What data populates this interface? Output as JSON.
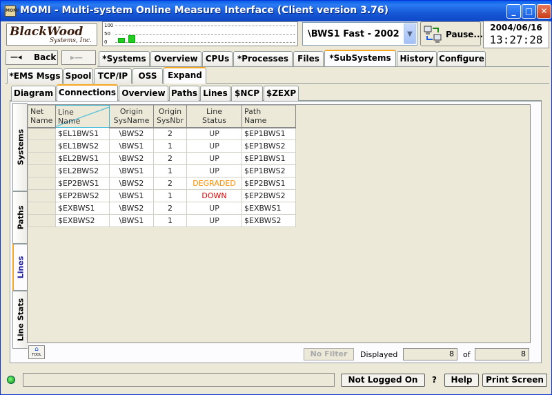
{
  "window": {
    "title": "MOMI - Multi-system Online Measure Interface (Client version 3.76)",
    "icon_text": "MOMI"
  },
  "logo": {
    "line1": "BlackWood",
    "line2": "Systems, Inc."
  },
  "graph": {
    "axis_labels": [
      "100",
      "50",
      "0"
    ],
    "bars": [
      0.3,
      0.45
    ]
  },
  "system_select": {
    "value": "\\BWS1 Fast - 2002"
  },
  "pause_button": {
    "label": "Pause..."
  },
  "clock": {
    "date": "2004/06/16",
    "time": "13:27:28"
  },
  "nav": {
    "back_label": "Back"
  },
  "main_tabs": [
    {
      "label": "*Systems"
    },
    {
      "label": "Overview"
    },
    {
      "label": "CPUs"
    },
    {
      "label": "*Processes"
    },
    {
      "label": "Files"
    },
    {
      "label": "*SubSystems",
      "selected": true
    },
    {
      "label": "History"
    },
    {
      "label": "Configure"
    }
  ],
  "sub_tabs": [
    {
      "label": "*EMS Msgs"
    },
    {
      "label": "Spool"
    },
    {
      "label": "TCP/IP"
    },
    {
      "label": "OSS"
    },
    {
      "label": "Expand",
      "selected": true
    }
  ],
  "expand_tabs": [
    {
      "label": "Diagram"
    },
    {
      "label": "Connections",
      "selected": true
    },
    {
      "label": "Overview"
    },
    {
      "label": "Paths"
    },
    {
      "label": "Lines"
    },
    {
      "label": "$NCP"
    },
    {
      "label": "$ZEXP"
    }
  ],
  "side_tabs": [
    {
      "label": "Systems"
    },
    {
      "label": "Paths"
    },
    {
      "label": "Lines",
      "selected": true
    },
    {
      "label": "Line Stats"
    }
  ],
  "table": {
    "headers": [
      [
        "Net",
        "Name"
      ],
      [
        "Line",
        "Name"
      ],
      [
        "Origin",
        "SysName"
      ],
      [
        "Origin",
        "SysNbr"
      ],
      [
        "Line",
        "Status"
      ],
      [
        "Path",
        "Name"
      ]
    ],
    "rows": [
      {
        "net": "",
        "line": "$EL1BWS1",
        "sysname": "\\BWS2",
        "sysnbr": "2",
        "status": "UP",
        "path": "$EP1BWS1"
      },
      {
        "net": "",
        "line": "$EL1BWS2",
        "sysname": "\\BWS1",
        "sysnbr": "1",
        "status": "UP",
        "path": "$EP1BWS2"
      },
      {
        "net": "",
        "line": "$EL2BWS1",
        "sysname": "\\BWS2",
        "sysnbr": "2",
        "status": "UP",
        "path": "$EP1BWS1"
      },
      {
        "net": "",
        "line": "$EL2BWS2",
        "sysname": "\\BWS1",
        "sysnbr": "1",
        "status": "UP",
        "path": "$EP1BWS2"
      },
      {
        "net": "",
        "line": "$EP2BWS1",
        "sysname": "\\BWS2",
        "sysnbr": "2",
        "status": "DEGRADED",
        "path": "$EP2BWS1"
      },
      {
        "net": "",
        "line": "$EP2BWS2",
        "sysname": "\\BWS1",
        "sysnbr": "1",
        "status": "DOWN",
        "path": "$EP2BWS2"
      },
      {
        "net": "",
        "line": "$EXBWS1",
        "sysname": "\\BWS2",
        "sysnbr": "2",
        "status": "UP",
        "path": "$EXBWS1"
      },
      {
        "net": "",
        "line": "$EXBWS2",
        "sysname": "\\BWS1",
        "sysnbr": "1",
        "status": "UP",
        "path": "$EXBWS2"
      }
    ],
    "status_colors": {
      "UP": "#333333",
      "DEGRADED": "#ff8c00",
      "DOWN": "#e00000"
    }
  },
  "footer": {
    "tool_label": "TOOL",
    "no_filter_label": "No Filter",
    "displayed_label": "Displayed",
    "displayed_value": "8",
    "of_label": "of",
    "total_value": "8"
  },
  "status_bar": {
    "login_label": "Not Logged On",
    "question_label": "?",
    "help_label": "Help",
    "print_label": "Print Screen"
  }
}
